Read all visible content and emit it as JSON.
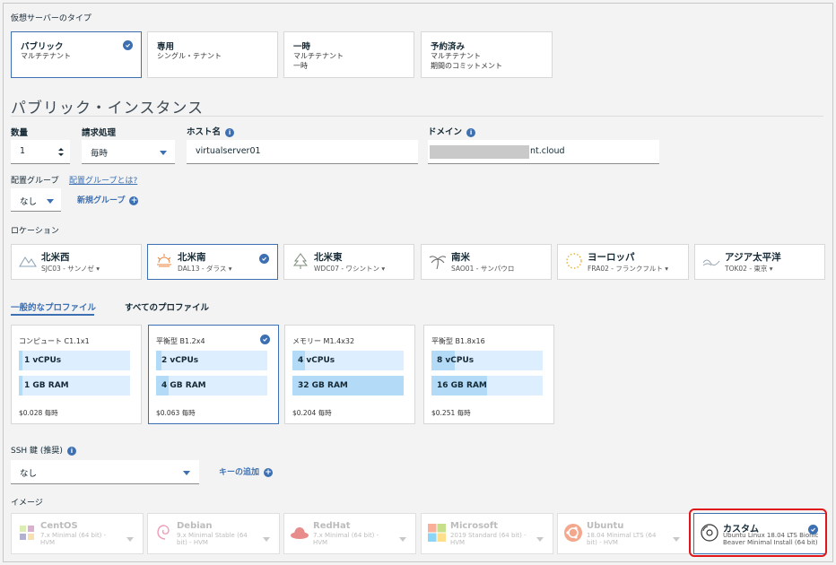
{
  "server_type": {
    "label": "仮想サーバーのタイプ",
    "options": [
      {
        "title": "パブリック",
        "sub1": "マルチテナント",
        "sub2": "",
        "selected": true
      },
      {
        "title": "専用",
        "sub1": "シングル・テナント",
        "sub2": "",
        "selected": false
      },
      {
        "title": "一時",
        "sub1": "マルチテナント",
        "sub2": "一時",
        "selected": false
      },
      {
        "title": "予約済み",
        "sub1": "マルチテナント",
        "sub2": "期間のコミットメント",
        "selected": false
      }
    ]
  },
  "heading": "パブリック・インスタンス",
  "quantity": {
    "label": "数量",
    "value": "1"
  },
  "billing": {
    "label": "請求処理",
    "value": "毎時"
  },
  "hostname": {
    "label": "ホスト名",
    "value": "virtualserver01"
  },
  "domain": {
    "label": "ドメイン",
    "value": "nt.cloud"
  },
  "placement": {
    "label": "配置グループ",
    "help_link": "配置グループとは?",
    "value": "なし",
    "new_link": "新規グループ"
  },
  "location": {
    "label": "ロケーション",
    "items": [
      {
        "name": "北米西",
        "dc": "SJC03 - サンノゼ",
        "icon": "mountain-icon",
        "selected": false,
        "dropdown": true
      },
      {
        "name": "北米南",
        "dc": "DAL13 - ダラス",
        "icon": "sun-icon",
        "selected": true,
        "dropdown": true
      },
      {
        "name": "北米東",
        "dc": "WDC07 - ワシントン",
        "icon": "tree-icon",
        "selected": false,
        "dropdown": true
      },
      {
        "name": "南米",
        "dc": "SAO01 - サンパウロ",
        "icon": "palm-icon",
        "selected": false,
        "dropdown": false
      },
      {
        "name": "ヨーロッパ",
        "dc": "FRA02 - フランクフルト",
        "icon": "stars-icon",
        "selected": false,
        "dropdown": true
      },
      {
        "name": "アジア太平洋",
        "dc": "TOK02 - 東京",
        "icon": "wave-icon",
        "selected": false,
        "dropdown": true
      }
    ]
  },
  "profile_tabs": [
    "一般的なプロファイル",
    "すべてのプロファイル"
  ],
  "profiles": [
    {
      "name": "コンピュート C1.1x1",
      "cpu": "1 vCPUs",
      "ram": "1 GB RAM",
      "price": "$0.028 毎時",
      "cpu_fill": 0.03,
      "ram_fill": 0.03,
      "selected": false
    },
    {
      "name": "平衡型 B1.2x4",
      "cpu": "2 vCPUs",
      "ram": "4 GB RAM",
      "price": "$0.063 毎時",
      "cpu_fill": 0.05,
      "ram_fill": 0.11,
      "selected": true
    },
    {
      "name": "メモリー M1.4x32",
      "cpu": "4 vCPUs",
      "ram": "32 GB RAM",
      "price": "$0.204 毎時",
      "cpu_fill": 0.11,
      "ram_fill": 1.0,
      "selected": false
    },
    {
      "name": "平衡型 B1.8x16",
      "cpu": "8 vCPUs",
      "ram": "16 GB RAM",
      "price": "$0.251 毎時",
      "cpu_fill": 0.21,
      "ram_fill": 0.5,
      "selected": false
    }
  ],
  "ssh": {
    "label": "SSH 鍵 (推奨)",
    "value": "なし",
    "add_link": "キーの追加"
  },
  "image": {
    "label": "イメージ",
    "items": [
      {
        "name": "CentOS",
        "sub": "7.x Minimal (64 bit) - HVM",
        "icon": "centos-icon",
        "selected": false
      },
      {
        "name": "Debian",
        "sub": "9.x Minimal Stable (64 bit) - HVM",
        "icon": "debian-icon",
        "selected": false
      },
      {
        "name": "RedHat",
        "sub": "7.x Minimal (64 bit) - HVM",
        "icon": "redhat-icon",
        "selected": false
      },
      {
        "name": "Microsoft",
        "sub": "2019 Standard (64 bit) - HVM",
        "icon": "windows-icon",
        "selected": false
      },
      {
        "name": "Ubuntu",
        "sub": "18.04 Minimal LTS (64 bit) - HVM",
        "icon": "ubuntu-icon",
        "selected": false
      },
      {
        "name": "カスタム",
        "sub": "Ubuntu Linux 18.04 LTS Bionic Beaver Minimal Install (64 bit)",
        "icon": "disk-icon",
        "selected": true
      }
    ]
  },
  "colors": {
    "accent": "#3d70b2",
    "highlight": "#e0161a"
  }
}
